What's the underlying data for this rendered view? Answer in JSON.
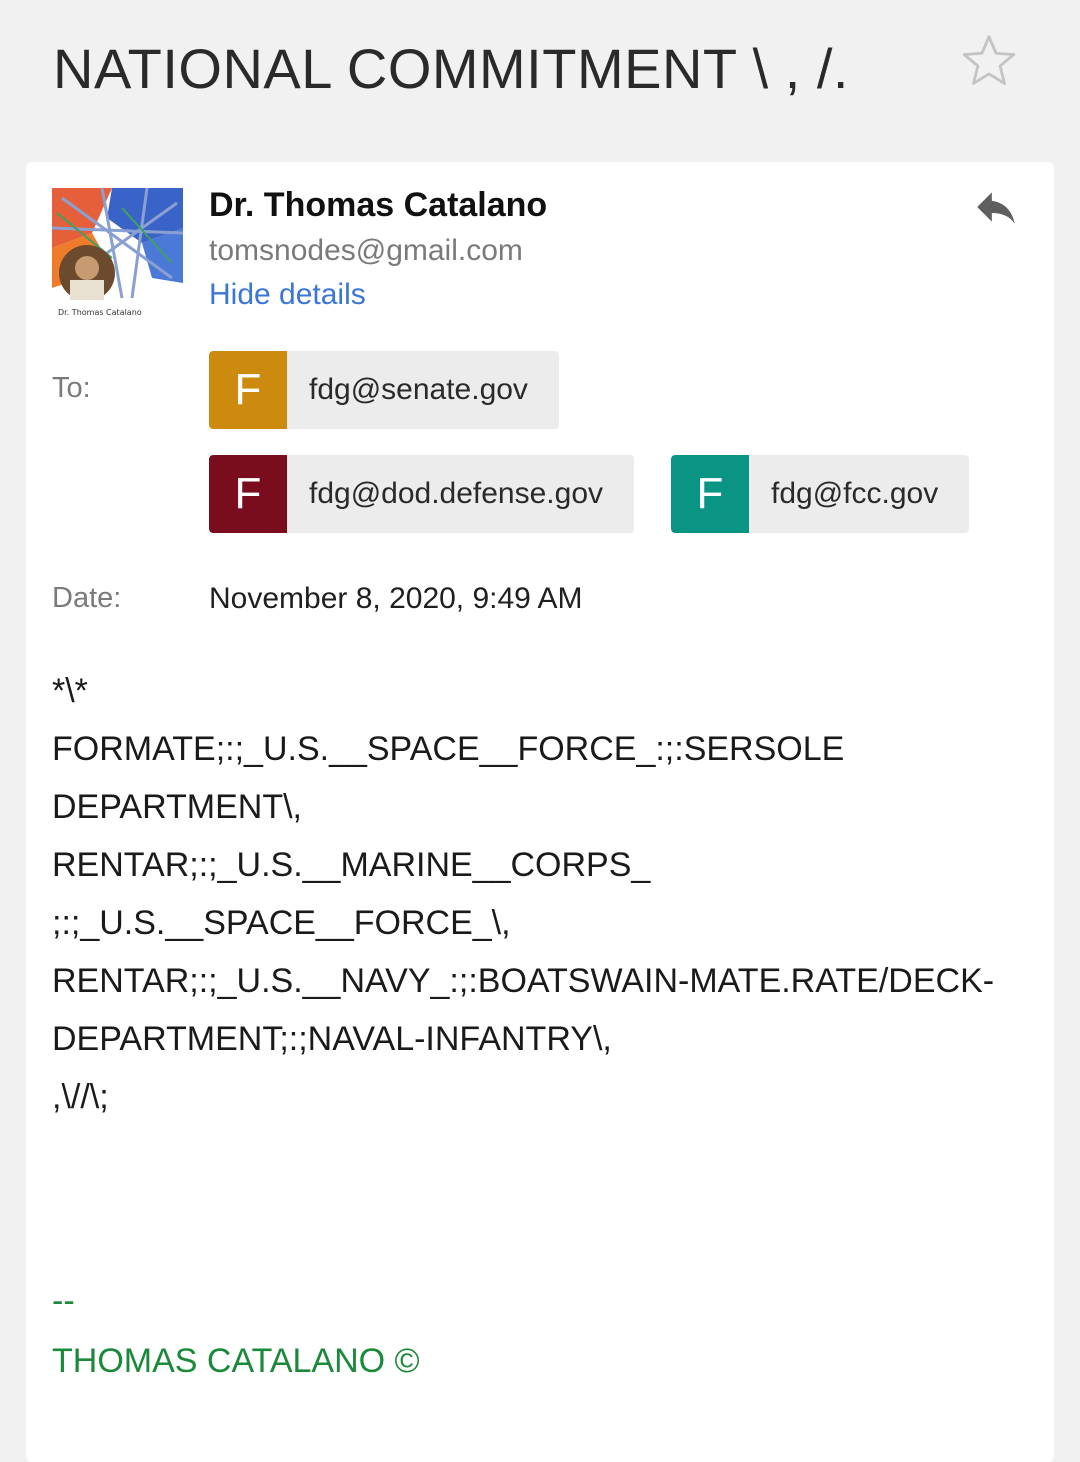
{
  "email": {
    "subject": "NATIONAL COMMITMENT \\ , /.",
    "sender": {
      "name": "Dr. Thomas Catalano",
      "email": "tomsnodes@gmail.com",
      "avatar_caption": "Dr. Thomas Catalano"
    },
    "hide_details_label": "Hide details",
    "to_label": "To:",
    "recipients": [
      {
        "initial": "F",
        "email": "fdg@senate.gov",
        "color": "#cc8a0e"
      },
      {
        "initial": "F",
        "email": "fdg@dod.defense.gov",
        "color": "#7a0d1d"
      },
      {
        "initial": "F",
        "email": "fdg@fcc.gov",
        "color": "#0a9484"
      }
    ],
    "date_label": "Date:",
    "date_value": "November 8, 2020, 9:49 AM",
    "body_lines": [
      "*\\*",
      "FORMATE;:;_U.S.__SPACE__FORCE_:;:SERSOLE",
      "DEPARTMENT\\,",
      "RENTAR;:;_U.S.__MARINE__CORPS_",
      ";:;_U.S.__SPACE__FORCE_\\,",
      "RENTAR;:;_U.S.__NAVY_:;:BOATSWAIN-MATE.RATE/DECK-",
      "DEPARTMENT;:;NAVAL-INFANTRY\\,",
      ",\\//\\;"
    ],
    "signature_separator": "--",
    "signature": "THOMAS CATALANO ©"
  },
  "icons": {
    "star": "star-outline-icon",
    "reply": "reply-icon"
  },
  "colors": {
    "link": "#3a76d6",
    "signature": "#1a8a3a",
    "background": "#f1f1f1"
  }
}
